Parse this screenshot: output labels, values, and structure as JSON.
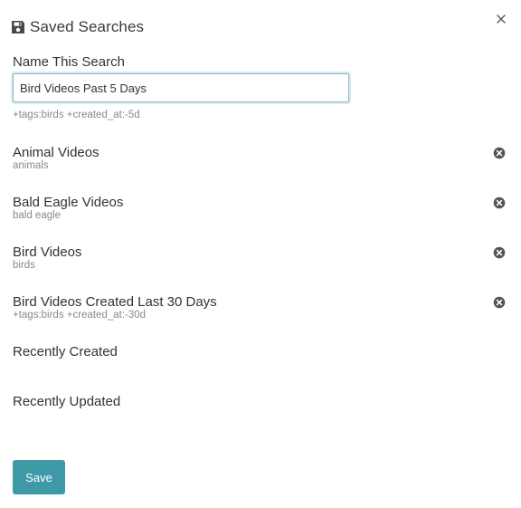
{
  "header": {
    "icon": "floppy-disk-icon",
    "title": "Saved Searches",
    "close_icon": "close-icon"
  },
  "form": {
    "label": "Name This Search",
    "value": "Bird Videos Past 5 Days",
    "query_hint": "+tags:birds +created_at:-5d"
  },
  "saved_searches": [
    {
      "title": "Animal Videos",
      "query": "animals",
      "remove_icon": "remove-circle-icon"
    },
    {
      "title": "Bald Eagle Videos",
      "query": "bald eagle",
      "remove_icon": "remove-circle-icon"
    },
    {
      "title": "Bird Videos",
      "query": "birds",
      "remove_icon": "remove-circle-icon"
    },
    {
      "title": "Bird Videos Created Last 30 Days",
      "query": "+tags:birds +created_at:-30d",
      "remove_icon": "remove-circle-icon"
    }
  ],
  "quick_searches": [
    {
      "title": "Recently Created"
    },
    {
      "title": "Recently Updated"
    }
  ],
  "footer": {
    "save_label": "Save"
  },
  "colors": {
    "accent": "#3f9aa7",
    "text": "#333333",
    "muted": "#8a8a8a",
    "icon": "#555555"
  }
}
